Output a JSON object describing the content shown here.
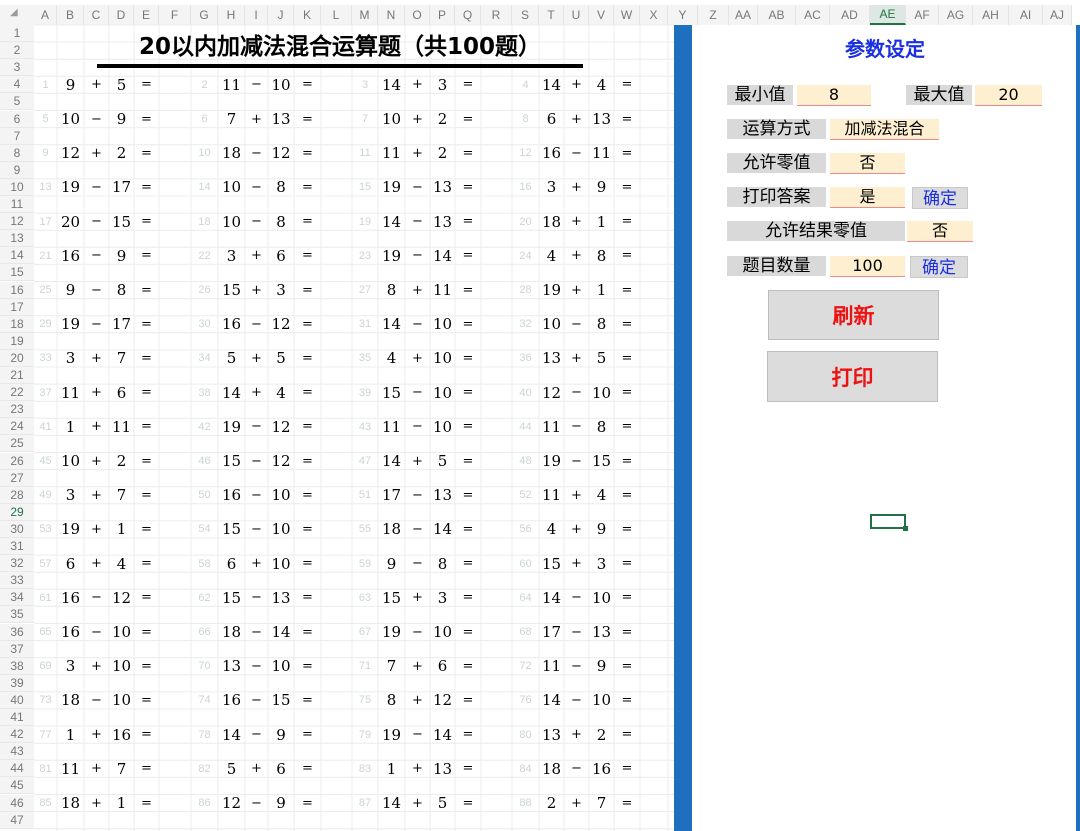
{
  "sheet": {
    "title": "20以内加减法混合运算题（共100题）",
    "selected_column": "AE",
    "selected_row": 29,
    "corner_glyph": "◢",
    "columns": [
      "A",
      "B",
      "C",
      "D",
      "E",
      "F",
      "G",
      "H",
      "I",
      "J",
      "K",
      "L",
      "M",
      "N",
      "O",
      "P",
      "Q",
      "R",
      "S",
      "T",
      "U",
      "V",
      "W",
      "X",
      "Y",
      "Z",
      "AA",
      "AB",
      "AC",
      "AD",
      "AE",
      "AF",
      "AG",
      "AH",
      "AI",
      "AJ"
    ],
    "rows": [
      1,
      2,
      3,
      4,
      5,
      6,
      7,
      8,
      9,
      10,
      11,
      12,
      13,
      14,
      15,
      16,
      17,
      18,
      19,
      20,
      21,
      22,
      23,
      24,
      25,
      26,
      27,
      28,
      29,
      30,
      31,
      32,
      33,
      34,
      35,
      36,
      37,
      38,
      39,
      40,
      41,
      42,
      43,
      44,
      45,
      46,
      47
    ],
    "problems": [
      [
        "1",
        "9",
        "+",
        "5",
        "=",
        "2",
        "11",
        "−",
        "10",
        "=",
        "3",
        "14",
        "+",
        "3",
        "=",
        "4",
        "14",
        "+",
        "4",
        "="
      ],
      [
        "5",
        "10",
        "−",
        "9",
        "=",
        "6",
        "7",
        "+",
        "13",
        "=",
        "7",
        "10",
        "+",
        "2",
        "=",
        "8",
        "6",
        "+",
        "13",
        "="
      ],
      [
        "9",
        "12",
        "+",
        "2",
        "=",
        "10",
        "18",
        "−",
        "12",
        "=",
        "11",
        "11",
        "+",
        "2",
        "=",
        "12",
        "16",
        "−",
        "11",
        "="
      ],
      [
        "13",
        "19",
        "−",
        "17",
        "=",
        "14",
        "10",
        "−",
        "8",
        "=",
        "15",
        "19",
        "−",
        "13",
        "=",
        "16",
        "3",
        "+",
        "9",
        "="
      ],
      [
        "17",
        "20",
        "−",
        "15",
        "=",
        "18",
        "10",
        "−",
        "8",
        "=",
        "19",
        "14",
        "−",
        "13",
        "=",
        "20",
        "18",
        "+",
        "1",
        "="
      ],
      [
        "21",
        "16",
        "−",
        "9",
        "=",
        "22",
        "3",
        "+",
        "6",
        "=",
        "23",
        "19",
        "−",
        "14",
        "=",
        "24",
        "4",
        "+",
        "8",
        "="
      ],
      [
        "25",
        "9",
        "−",
        "8",
        "=",
        "26",
        "15",
        "+",
        "3",
        "=",
        "27",
        "8",
        "+",
        "11",
        "=",
        "28",
        "19",
        "+",
        "1",
        "="
      ],
      [
        "29",
        "19",
        "−",
        "17",
        "=",
        "30",
        "16",
        "−",
        "12",
        "=",
        "31",
        "14",
        "−",
        "10",
        "=",
        "32",
        "10",
        "−",
        "8",
        "="
      ],
      [
        "33",
        "3",
        "+",
        "7",
        "=",
        "34",
        "5",
        "+",
        "5",
        "=",
        "35",
        "4",
        "+",
        "10",
        "=",
        "36",
        "13",
        "+",
        "5",
        "="
      ],
      [
        "37",
        "11",
        "+",
        "6",
        "=",
        "38",
        "14",
        "+",
        "4",
        "=",
        "39",
        "15",
        "−",
        "10",
        "=",
        "40",
        "12",
        "−",
        "10",
        "="
      ],
      [
        "41",
        "1",
        "+",
        "11",
        "=",
        "42",
        "19",
        "−",
        "12",
        "=",
        "43",
        "11",
        "−",
        "10",
        "=",
        "44",
        "11",
        "−",
        "8",
        "="
      ],
      [
        "45",
        "10",
        "+",
        "2",
        "=",
        "46",
        "15",
        "−",
        "12",
        "=",
        "47",
        "14",
        "+",
        "5",
        "=",
        "48",
        "19",
        "−",
        "15",
        "="
      ],
      [
        "49",
        "3",
        "+",
        "7",
        "=",
        "50",
        "16",
        "−",
        "10",
        "=",
        "51",
        "17",
        "−",
        "13",
        "=",
        "52",
        "11",
        "+",
        "4",
        "="
      ],
      [
        "53",
        "19",
        "+",
        "1",
        "=",
        "54",
        "15",
        "−",
        "10",
        "=",
        "55",
        "18",
        "−",
        "14",
        "=",
        "56",
        "4",
        "+",
        "9",
        "="
      ],
      [
        "57",
        "6",
        "+",
        "4",
        "=",
        "58",
        "6",
        "+",
        "10",
        "=",
        "59",
        "9",
        "−",
        "8",
        "=",
        "60",
        "15",
        "+",
        "3",
        "="
      ],
      [
        "61",
        "16",
        "−",
        "12",
        "=",
        "62",
        "15",
        "−",
        "13",
        "=",
        "63",
        "15",
        "+",
        "3",
        "=",
        "64",
        "14",
        "−",
        "10",
        "="
      ],
      [
        "65",
        "16",
        "−",
        "10",
        "=",
        "66",
        "18",
        "−",
        "14",
        "=",
        "67",
        "19",
        "−",
        "10",
        "=",
        "68",
        "17",
        "−",
        "13",
        "="
      ],
      [
        "69",
        "3",
        "+",
        "10",
        "=",
        "70",
        "13",
        "−",
        "10",
        "=",
        "71",
        "7",
        "+",
        "6",
        "=",
        "72",
        "11",
        "−",
        "9",
        "="
      ],
      [
        "73",
        "18",
        "−",
        "10",
        "=",
        "74",
        "16",
        "−",
        "15",
        "=",
        "75",
        "8",
        "+",
        "12",
        "=",
        "76",
        "14",
        "−",
        "10",
        "="
      ],
      [
        "77",
        "1",
        "+",
        "16",
        "=",
        "78",
        "14",
        "−",
        "9",
        "=",
        "79",
        "19",
        "−",
        "14",
        "=",
        "80",
        "13",
        "+",
        "2",
        "="
      ],
      [
        "81",
        "11",
        "+",
        "7",
        "=",
        "82",
        "5",
        "+",
        "6",
        "=",
        "83",
        "1",
        "+",
        "13",
        "=",
        "84",
        "18",
        "−",
        "16",
        "="
      ],
      [
        "85",
        "18",
        "+",
        "1",
        "=",
        "86",
        "12",
        "−",
        "9",
        "=",
        "87",
        "14",
        "+",
        "5",
        "=",
        "88",
        "2",
        "+",
        "7",
        "="
      ]
    ]
  },
  "panel": {
    "title": "参数设定",
    "min_label": "最小值",
    "min_value": "8",
    "max_label": "最大值",
    "max_value": "20",
    "method_label": "运算方式",
    "method_value": "加减法混合",
    "allow_zero_label": "允许零值",
    "allow_zero_value": "否",
    "print_answer_label": "打印答案",
    "print_answer_value": "是",
    "confirm1": "确定",
    "allow_result_zero_label": "允许结果零值",
    "allow_result_zero_value": "否",
    "count_label": "题目数量",
    "count_value": "100",
    "confirm2": "确定",
    "refresh_button": "刷新",
    "print_button": "打印"
  },
  "colors": {
    "accent_blue": "#1f6fbf",
    "title_blue": "#1a2fe0",
    "button_red": "#ee1111",
    "selection_green": "#217346",
    "value_bg": "#fdefd0"
  }
}
